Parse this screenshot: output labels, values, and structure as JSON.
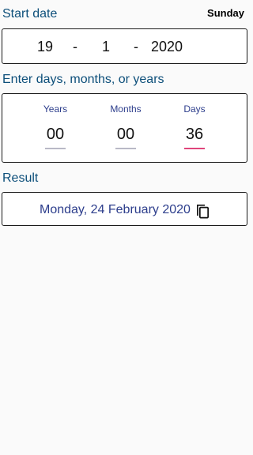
{
  "start_date": {
    "label": "Start date",
    "weekday": "Sunday",
    "day": "19",
    "month": "1",
    "year": "2020",
    "separator": "-"
  },
  "duration": {
    "label": "Enter days, months, or years",
    "years_label": "Years",
    "years_value": "00",
    "months_label": "Months",
    "months_value": "00",
    "days_label": "Days",
    "days_value": "36"
  },
  "result": {
    "label": "Result",
    "value": "Monday, 24 February 2020",
    "copy_icon": "copy-icon"
  },
  "colors": {
    "section_label": "#0d4f7a",
    "accent_text": "#2d3e8c",
    "active_underline": "#e0457b"
  }
}
